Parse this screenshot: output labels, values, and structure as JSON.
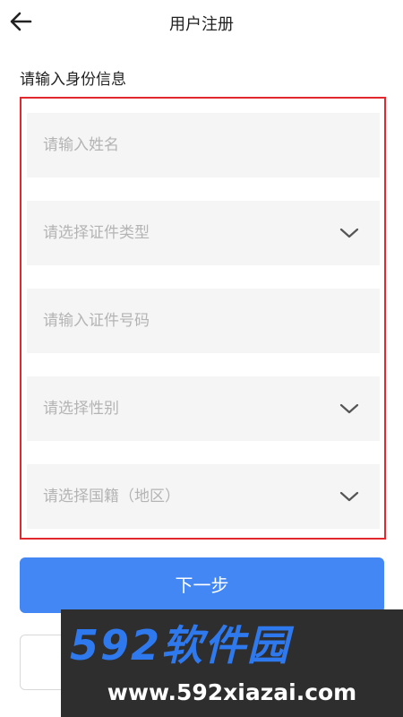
{
  "header": {
    "title": "用户注册",
    "back_icon": "arrow-left-icon"
  },
  "form": {
    "section_label": "请输入身份信息",
    "fields": [
      {
        "placeholder": "请输入姓名",
        "type": "text"
      },
      {
        "placeholder": "请选择证件类型",
        "type": "select",
        "icon": "chevron-down-icon"
      },
      {
        "placeholder": "请输入证件号码",
        "type": "text"
      },
      {
        "placeholder": "请选择性别",
        "type": "select",
        "icon": "chevron-down-icon"
      },
      {
        "placeholder": "请选择国籍（地区）",
        "type": "select",
        "icon": "chevron-down-icon"
      }
    ],
    "highlight_color": "#e0282e"
  },
  "actions": {
    "next_label": "下一步",
    "primary_color": "#4387f4"
  },
  "watermark": {
    "logo_text": "592软件园",
    "url": "www.592xiazai.com"
  }
}
